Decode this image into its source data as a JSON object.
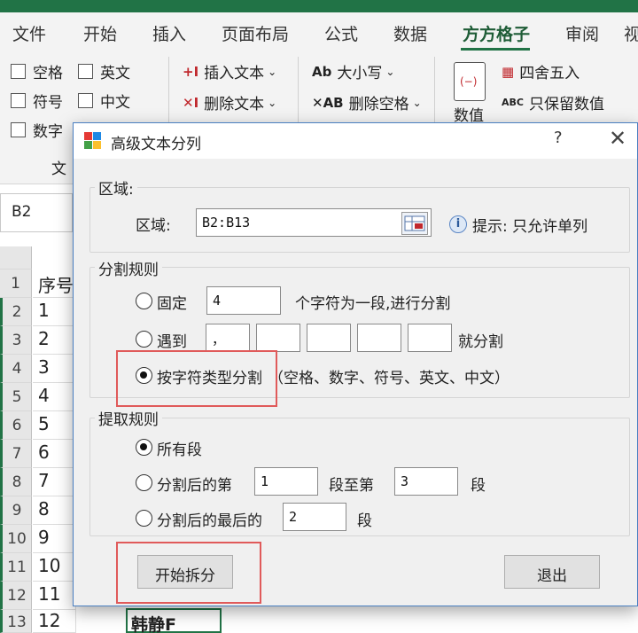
{
  "excel": {
    "ribbon_tabs": [
      "文件",
      "开始",
      "插入",
      "页面布局",
      "公式",
      "数据",
      "方方格子",
      "审阅",
      "视"
    ],
    "active_tab": "方方格子",
    "ribbon": {
      "checkboxes": [
        "空格",
        "英文",
        "符号",
        "中文",
        "数字"
      ],
      "insert_text": "插入文本",
      "delete_text": "删除文本",
      "case_label": "大小写",
      "delete_space": "删除空格",
      "round": "四舍五入",
      "keep_values": "只保留数值",
      "value_label": "数值",
      "group_label": "文"
    },
    "name_box": "B2",
    "row_headers": [
      "1",
      "2",
      "3",
      "4",
      "5",
      "6",
      "7",
      "8",
      "9",
      "10",
      "11",
      "12",
      "13"
    ],
    "col_a": [
      "序号",
      "1",
      "2",
      "3",
      "4",
      "5",
      "6",
      "7",
      "8",
      "9",
      "10",
      "11",
      "12"
    ],
    "bottom_cell": "韩静F"
  },
  "dialog": {
    "title": "高级文本分列",
    "help": "?",
    "close": "✕",
    "region_group": "区域:",
    "region_label": "区域:",
    "region_value": "B2:B13",
    "hint_icon": "i",
    "hint": "提示: 只允许单列",
    "split_group": "分割规则",
    "fixed_label": "固定",
    "fixed_value": "4",
    "fixed_suffix": "个字符为一段,进行分割",
    "meet_label": "遇到",
    "meet_values": [
      "，",
      "",
      "",
      "",
      ""
    ],
    "meet_suffix": "就分割",
    "type_label": "按字符类型分割",
    "type_desc": "（空格、数字、符号、英文、中文）",
    "extract_group": "提取规则",
    "all_label": "所有段",
    "range_prefix": "分割后的第",
    "range_from": "1",
    "range_mid": "段至第",
    "range_to": "3",
    "range_suffix": "段",
    "last_prefix": "分割后的最后的",
    "last_value": "2",
    "last_suffix": "段",
    "start_button": "开始拆分",
    "exit_button": "退出"
  },
  "colors": {
    "excel_green": "#217346",
    "highlight_red": "#e05a5a",
    "dialog_border": "#4a7fc1"
  }
}
